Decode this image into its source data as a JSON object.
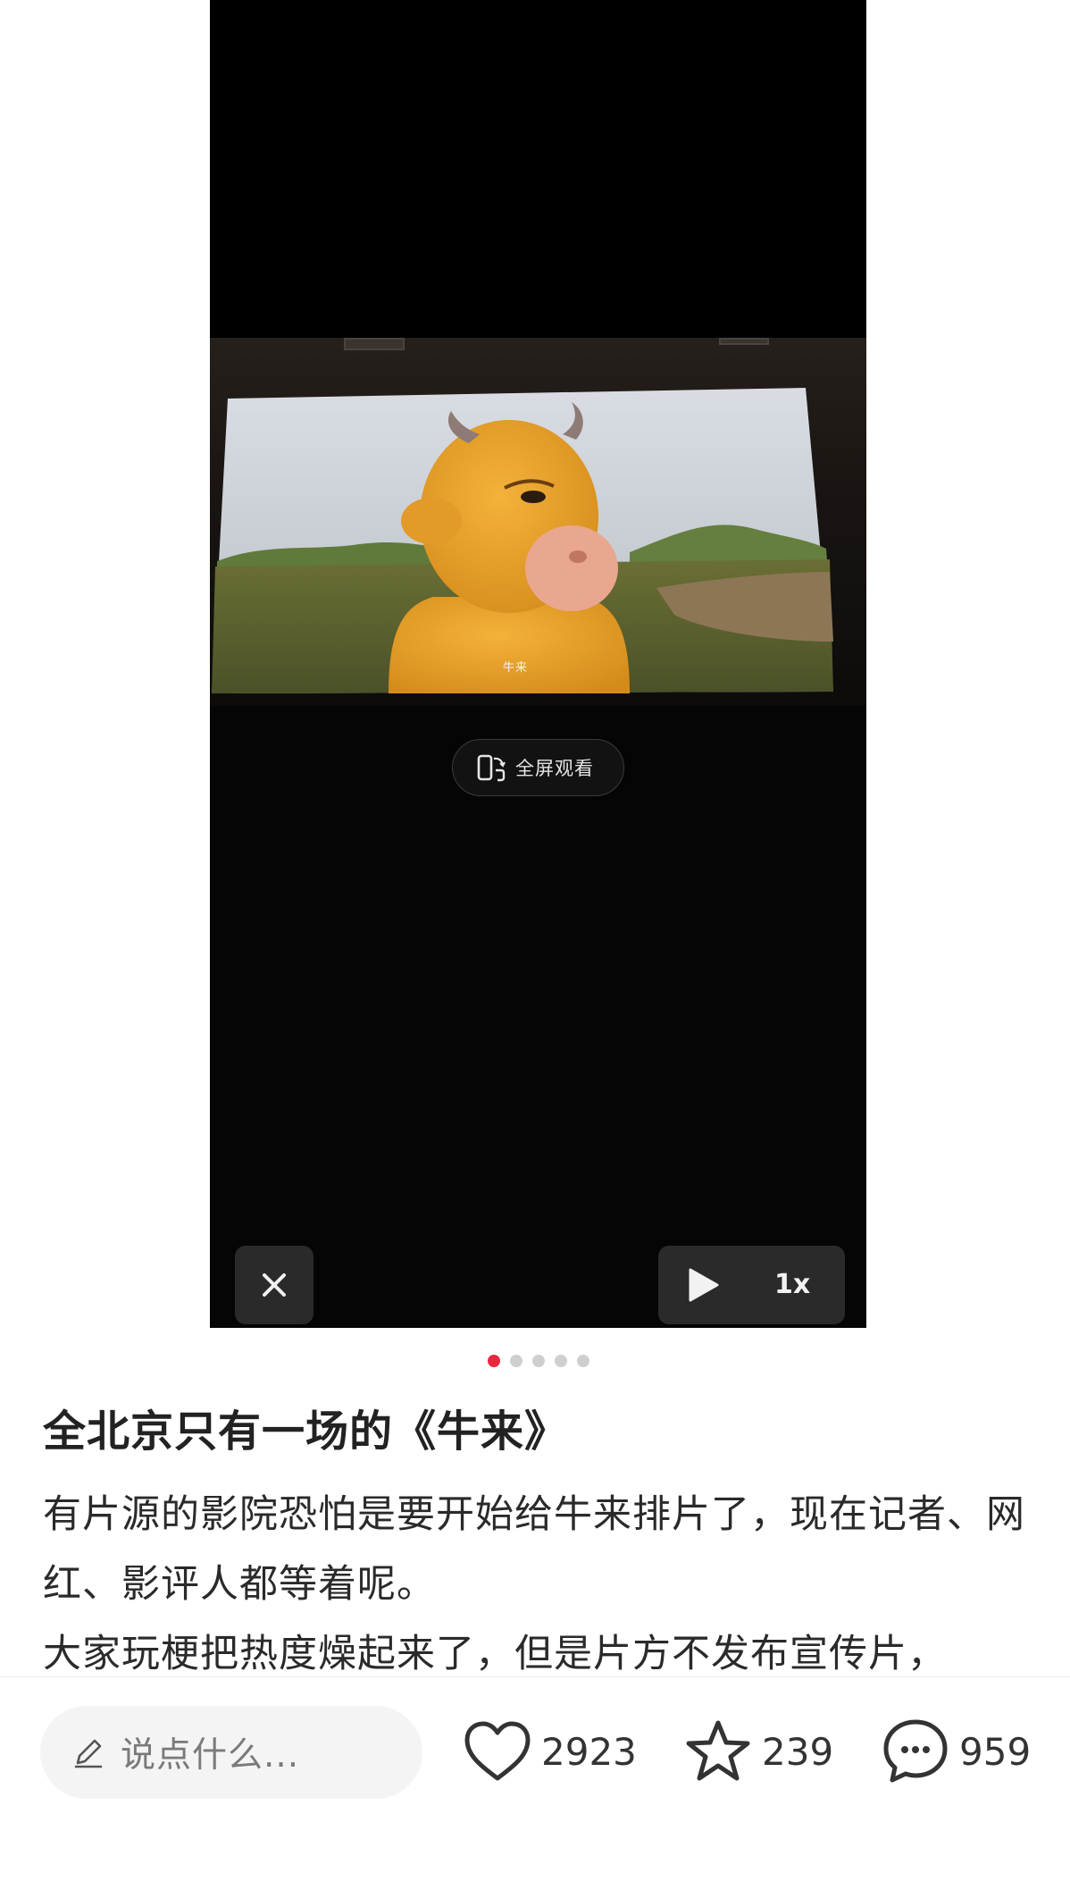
{
  "video": {
    "subtitle_mark": "牛来",
    "fullscreen_label": "全屏观看",
    "speed_label": "1x"
  },
  "pager": {
    "total": 5,
    "active_index": 0,
    "active_color": "#e8263f",
    "inactive_color": "#cfcfcf"
  },
  "post": {
    "title": "全北京只有一场的《牛来》",
    "body_line1": "有片源的影院恐怕是要开始给牛来排片了，现在记者、网红、影评人都等着呢。",
    "body_line2": "大家玩梗把热度燥起来了，但是片方不发布宣传片，"
  },
  "bottom_bar": {
    "comment_placeholder": "说点什么...",
    "like_count": "2923",
    "favorite_count": "239",
    "comment_count": "959"
  },
  "icons": {
    "fullscreen": "rotate-phone-icon",
    "close": "close-icon",
    "play": "play-icon",
    "pencil": "pencil-icon",
    "like": "heart-icon",
    "favorite": "star-icon",
    "comment": "chat-bubble-icon"
  }
}
